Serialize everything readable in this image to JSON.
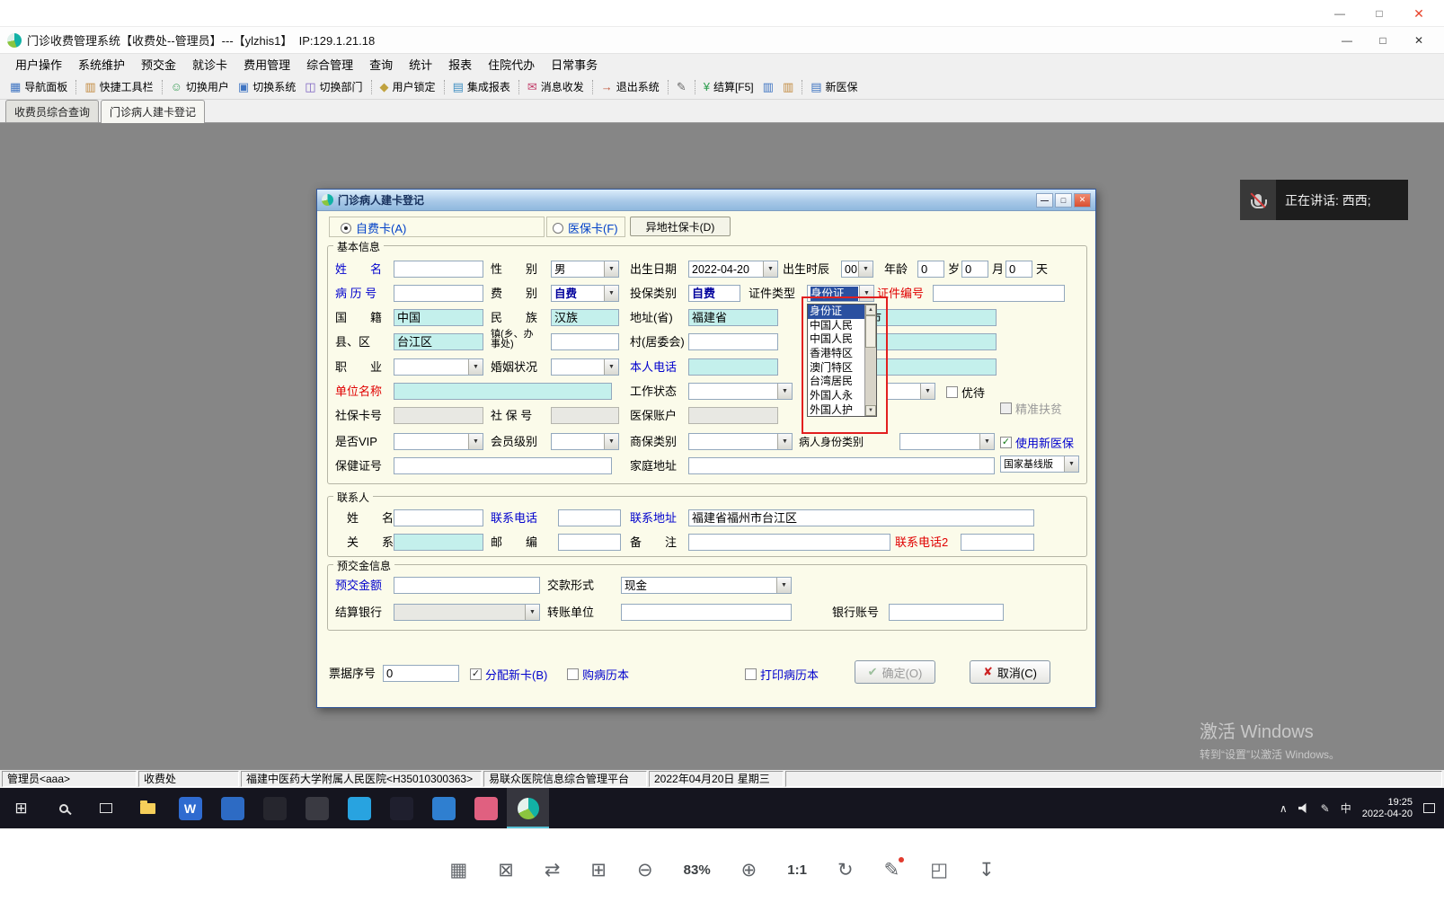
{
  "viewer": {
    "zoom_level": "83%",
    "tools": [
      {
        "name": "collage"
      },
      {
        "name": "screenshot"
      },
      {
        "name": "swap-image"
      },
      {
        "name": "fullscreen"
      },
      {
        "name": "zoom-out"
      },
      {
        "name": "zoom-level",
        "label": "83%"
      },
      {
        "name": "zoom-in"
      },
      {
        "name": "one-to-one",
        "label": "1:1"
      },
      {
        "name": "rotate"
      },
      {
        "name": "edit"
      },
      {
        "name": "crop"
      },
      {
        "name": "download"
      }
    ]
  },
  "app": {
    "title": "门诊收费管理系统【收费处--管理员】---【ylzhis1】  IP:129.1.21.18",
    "menu": [
      "用户操作",
      "系统维护",
      "预交金",
      "就诊卡",
      "费用管理",
      "综合管理",
      "查询",
      "统计",
      "报表",
      "住院代办",
      "日常事务"
    ],
    "toolbar": [
      {
        "icon": "nav",
        "label": "导航面板"
      },
      {
        "icon": "quick",
        "label": "快捷工具栏"
      },
      {
        "icon": "user",
        "label": "切换用户"
      },
      {
        "icon": "system",
        "label": "切换系统"
      },
      {
        "icon": "dept",
        "label": "切换部门"
      },
      {
        "icon": "lock",
        "label": "用户锁定"
      },
      {
        "icon": "report",
        "label": "集成报表"
      },
      {
        "icon": "msg",
        "label": "消息收发"
      },
      {
        "icon": "exit",
        "label": "退出系统"
      },
      {
        "icon": "edit",
        "label": ""
      },
      {
        "icon": "settle",
        "label": "结算[F5]"
      },
      {
        "icon": "book",
        "label": ""
      },
      {
        "icon": "book2",
        "label": ""
      },
      {
        "icon": "newmi",
        "label": "新医保"
      }
    ],
    "tabs": [
      {
        "label": "收费员综合查询",
        "active": false
      },
      {
        "label": "门诊病人建卡登记",
        "active": true
      }
    ]
  },
  "dialog": {
    "title": "门诊病人建卡登记",
    "radio": {
      "self": "自费卡(A)",
      "med": "医保卡(F)",
      "remote": "异地社保卡(D)"
    },
    "legends": {
      "basic": "基本信息",
      "contact": "联系人",
      "prepay": "预交金信息"
    },
    "b": {
      "name_l": "姓　　名",
      "sex_l": "性　　别",
      "sex_v": "男",
      "dob_l": "出生日期",
      "dob_v": "2022-04-20",
      "bh_l": "出生时辰",
      "bh_v": "00",
      "age_l": "年龄",
      "age_y": "0",
      "age_yu": "岁",
      "age_m": "0",
      "age_mu": "月",
      "age_d": "0",
      "age_du": "天",
      "mrn_l": "病 历 号",
      "fee_l": "费　　别",
      "fee_v": "自费",
      "ins_l": "投保类别",
      "ins_v": "自费",
      "idt_l": "证件类型",
      "idt_v": "身份证",
      "idn_l": "证件编号",
      "nat_l": "国　　籍",
      "nat_v": "中国",
      "eth_l": "民　　族",
      "eth_v": "汉族",
      "addr_l": "地址(省)",
      "addr_v": "福建省",
      "city_v": "福州市",
      "cty_l": "县、区",
      "cty_v": "台江区",
      "town_l1": "镇(乡、办",
      "town_l2": "事处)",
      "vil_l": "村(居委会)",
      "job_l": "职　　业",
      "mar_l": "婚姻状况",
      "tel_l": "本人电话",
      "org_l": "单位名称",
      "work_l": "工作状态",
      "youdai": "优待",
      "fupin": "精准扶贫",
      "ssc_l": "社保卡号",
      "ssn_l": "社 保 号",
      "mia_l": "医保账户",
      "vip_l": "是否VIP",
      "mem_l": "会员级别",
      "com_l": "商保类别",
      "pit_l": "病人身份类别",
      "newmi": "使用新医保",
      "health_l": "保健证号",
      "home_l": "家庭地址",
      "baseline": "国家基线版"
    },
    "c": {
      "name_l": "姓　　名",
      "tel_l": "联系电话",
      "addr_l": "联系地址",
      "addr_v": "福建省福州市台江区",
      "rel_l": "关　　系",
      "zip_l": "邮　　编",
      "note_l": "备　　注",
      "tel2_l": "联系电话2"
    },
    "p": {
      "amt_l": "预交金额",
      "pay_l": "交款形式",
      "pay_v": "现金",
      "bank_l": "结算银行",
      "trans_l": "转账单位",
      "acct_l": "银行账号"
    },
    "f": {
      "bill_l": "票据序号",
      "bill_v": "0",
      "newcard": "分配新卡(B)",
      "book": "购病历本",
      "print": "打印病历本",
      "ok": "确定(O)",
      "cancel": "取消(C)"
    },
    "dd": {
      "items": [
        "身份证",
        "中国人民",
        "中国人民",
        "香港特区",
        "澳门特区",
        "台湾居民",
        "外国人永",
        "外国人护"
      ]
    }
  },
  "toast": {
    "text": "正在讲话: 西西;"
  },
  "watermark": {
    "line1": "激活 Windows",
    "line2": "转到“设置”以激活 Windows。"
  },
  "statusbar": [
    "管理员<aaa>",
    "收费处",
    "福建中医药大学附属人民医院<H35010300363>",
    "易联众医院信息综合管理平台",
    "2022年04月20日 星期三"
  ],
  "taskbar": {
    "ime": "中",
    "time": "19:25",
    "date": "2022-04-20",
    "apps": [
      {
        "name": "start"
      },
      {
        "name": "search"
      },
      {
        "name": "task-view"
      },
      {
        "name": "file-explorer"
      },
      {
        "name": "wps",
        "glyph": "W"
      },
      {
        "name": "app-blue"
      },
      {
        "name": "app-dark"
      },
      {
        "name": "app-camera"
      },
      {
        "name": "app-messenger"
      },
      {
        "name": "app-qq"
      },
      {
        "name": "app-monitor"
      },
      {
        "name": "app-pink"
      },
      {
        "name": "his-app",
        "active": true
      }
    ]
  },
  "colors": {
    "field_cyan": "#c4f0ec",
    "highlight_blue": "#2a50a0",
    "annotation_red": "#e21f1f",
    "dialog_bg": "#fbfbea"
  }
}
